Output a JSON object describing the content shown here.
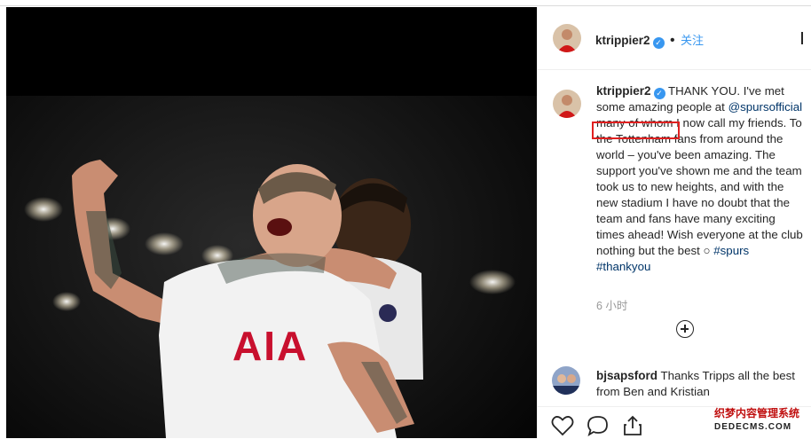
{
  "post": {
    "author": "ktrippier2",
    "follow_label": "关注",
    "caption_intro": "THANK YOU. I've met some amazing people at",
    "mention": "@spursofficial",
    "caption_rest": "many of whom I now call my friends. To the Tottenham fans from around the world – you've been amazing. The support you've shown me and the team took us to new heights, and with the new stadium I have no doubt that the team and fans have many exciting times ahead! Wish everyone at the club nothing but the best",
    "hashtag_1": "#spurs",
    "hashtag_2": "#thankyou",
    "timestamp": "6 小时",
    "photo_sponsor": "AIA",
    "verified_mark": "✓"
  },
  "comment": {
    "author": "bjsapsford",
    "text": "Thanks Tripps all the best from Ben and Kristian"
  },
  "actions": {
    "icons": [
      "heart-icon",
      "comment-icon",
      "share-icon"
    ]
  },
  "watermark": {
    "line1": "织梦内容管理系统",
    "line2": "DEDECMS.COM"
  },
  "colors": {
    "link_blue": "#3897f0",
    "mention_dark": "#003569",
    "highlight_red": "#e02020"
  }
}
